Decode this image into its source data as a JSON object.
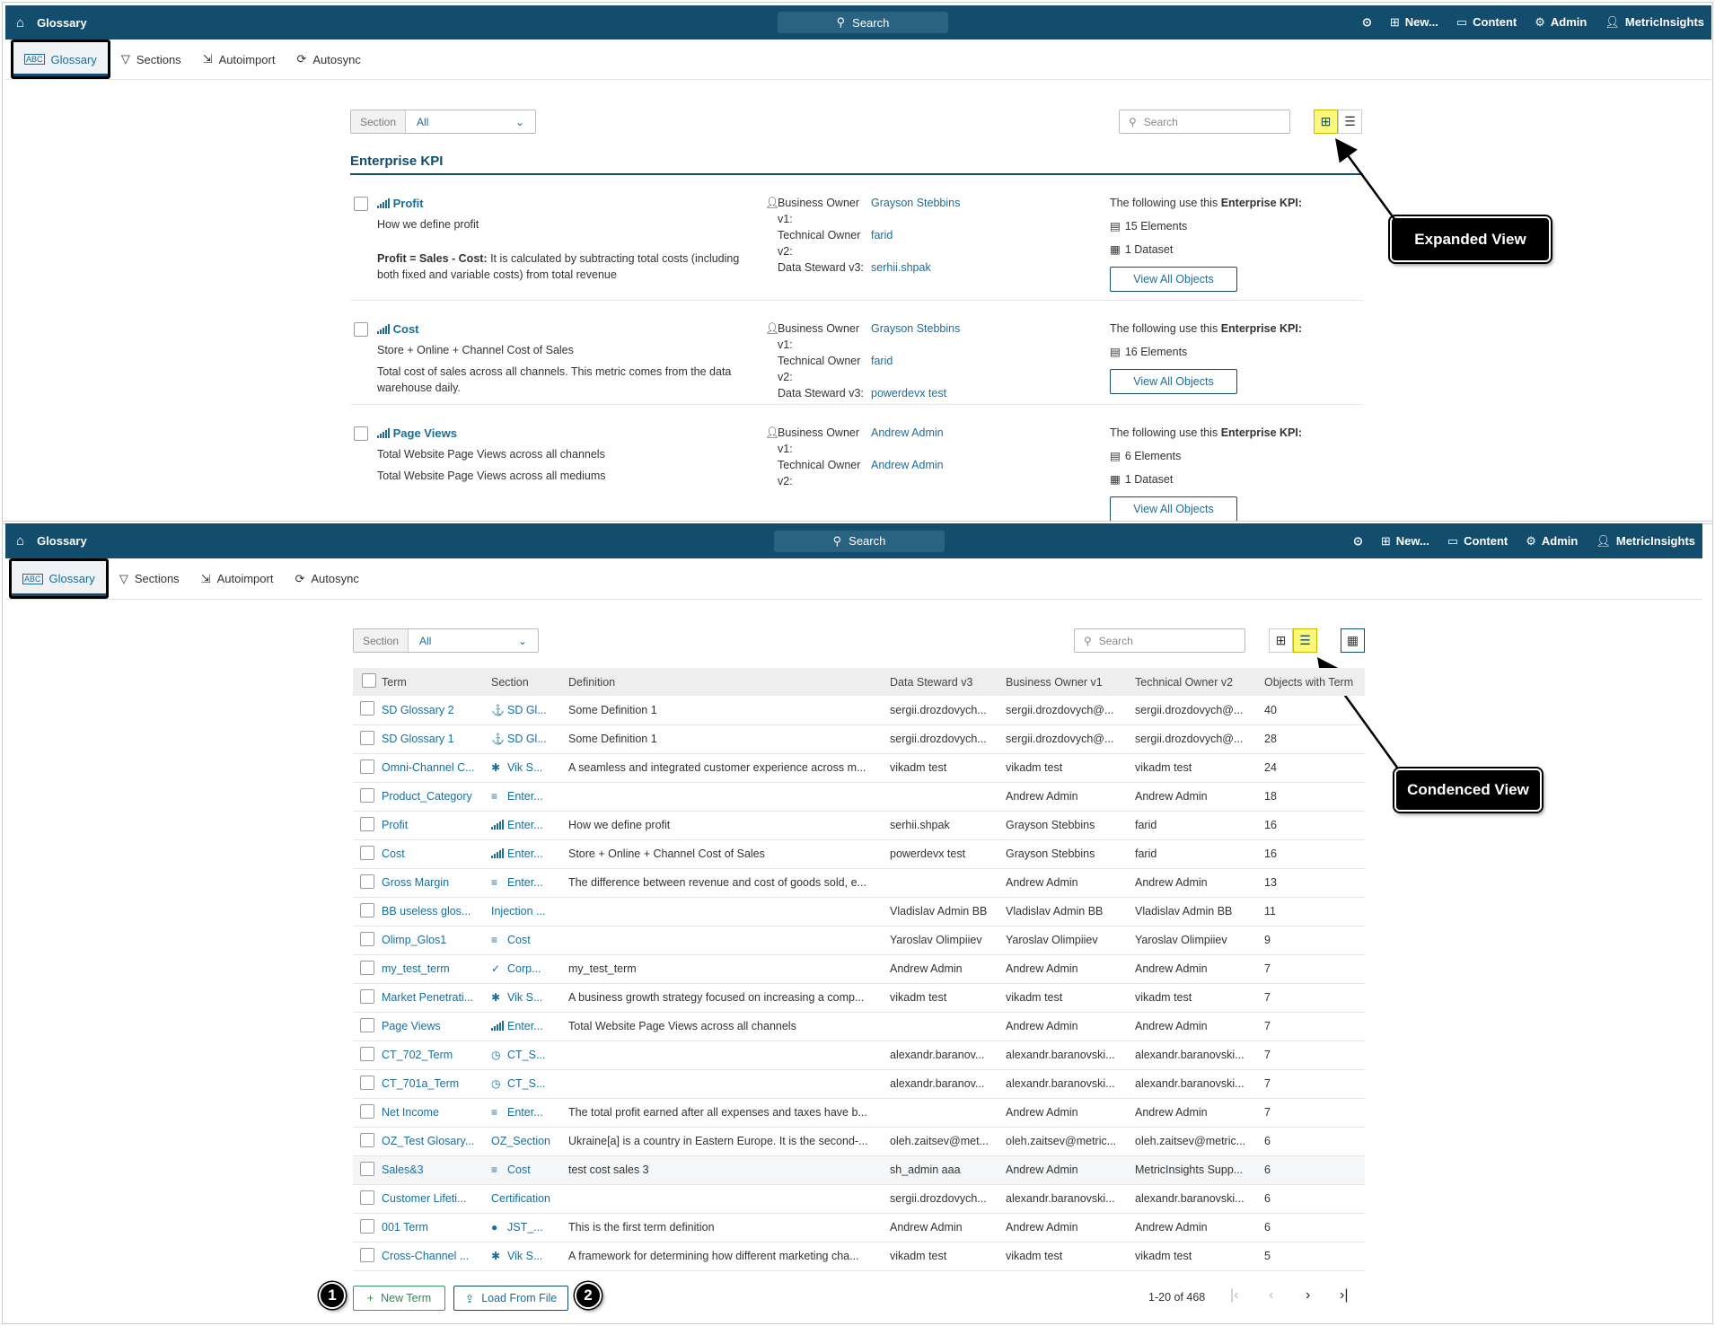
{
  "colors": {
    "brand": "#124d6e",
    "link": "#1a6e9a",
    "highlight": "#fbf77a"
  },
  "topbar": {
    "title": "Glossary",
    "search": "Search",
    "new": "New...",
    "content": "Content",
    "admin": "Admin",
    "user": "MetricInsights"
  },
  "tabs": [
    "Glossary",
    "Sections",
    "Autoimport",
    "Autosync"
  ],
  "filters": {
    "section_label": "Section",
    "section_value": "All",
    "search_placeholder": "Search"
  },
  "expanded": {
    "section_title": "Enterprise KPI",
    "uses_prefix": "The following use this ",
    "uses_bold": "Enterprise KPI:",
    "view_all": "View All Objects",
    "labels": {
      "bo1": "Business Owner",
      "bo2": "v1:",
      "to1": "Technical Owner",
      "to2": "v2:",
      "ds": "Data Steward v3:"
    },
    "items": [
      {
        "title": "Profit",
        "desc1": "How we define profit",
        "desc2_bold": "Profit = Sales - Cost:",
        "desc2": " It is calculated by subtracting total costs (including both fixed and variable costs) from total revenue",
        "business_owner": "Grayson Stebbins",
        "technical_owner": "farid",
        "data_steward": "serhii.shpak",
        "elements": "15 Elements",
        "datasets": "1 Dataset"
      },
      {
        "title": "Cost",
        "desc1": "Store + Online + Channel Cost of Sales",
        "desc2_bold": "",
        "desc2": "Total cost of sales across all channels. This metric comes from the data warehouse daily.",
        "business_owner": "Grayson Stebbins",
        "technical_owner": "farid",
        "data_steward": "powerdevx test",
        "elements": "16 Elements",
        "datasets": ""
      },
      {
        "title": "Page Views",
        "desc1": "Total Website Page Views across all channels",
        "desc2_bold": "",
        "desc2": "Total Website Page Views across all mediums",
        "business_owner": "Andrew Admin",
        "technical_owner": "Andrew Admin",
        "data_steward": "",
        "elements": "6 Elements",
        "datasets": "1 Dataset"
      }
    ]
  },
  "callouts": {
    "expanded": "Expanded View",
    "condensed": "Condenced View",
    "badge1": "1",
    "badge2": "2"
  },
  "table": {
    "columns": [
      "Term",
      "Section",
      "Definition",
      "Data Steward v3",
      "Business Owner v1",
      "Technical Owner v2",
      "Objects with Term"
    ],
    "rows": [
      {
        "term": "SD Glossary 2",
        "icon": "anchor-icon",
        "section": "SD Gl...",
        "definition": "Some Definition 1",
        "steward": "sergii.drozdovych...",
        "bo": "sergii.drozdovych@...",
        "to": "sergii.drozdovych@...",
        "objects": "40"
      },
      {
        "term": "SD Glossary 1",
        "icon": "anchor-icon",
        "section": "SD Gl...",
        "definition": "Some Definition 1",
        "steward": "sergii.drozdovych...",
        "bo": "sergii.drozdovych@...",
        "to": "sergii.drozdovych@...",
        "objects": "28"
      },
      {
        "term": "Omni-Channel C...",
        "icon": "bug-icon",
        "section": "Vik S...",
        "definition": "A seamless and integrated customer experience across m...",
        "steward": "vikadm test",
        "bo": "vikadm test",
        "to": "vikadm test",
        "objects": "24"
      },
      {
        "term": "Product_Category",
        "icon": "list-icon",
        "section": "Enter...",
        "definition": "",
        "steward": "",
        "bo": "Andrew Admin",
        "to": "Andrew Admin",
        "objects": "18"
      },
      {
        "term": "Profit",
        "icon": "bar-chart-icon",
        "section": "Enter...",
        "definition": "How we define profit",
        "steward": "serhii.shpak",
        "bo": "Grayson Stebbins",
        "to": "farid",
        "objects": "16"
      },
      {
        "term": "Cost",
        "icon": "bar-chart-icon",
        "section": "Enter...",
        "definition": "Store + Online + Channel Cost of Sales",
        "steward": "powerdevx test",
        "bo": "Grayson Stebbins",
        "to": "farid",
        "objects": "16"
      },
      {
        "term": "Gross Margin",
        "icon": "list-icon",
        "section": "Enter...",
        "definition": "The difference between revenue and cost of goods sold, e...",
        "steward": "",
        "bo": "Andrew Admin",
        "to": "Andrew Admin",
        "objects": "13"
      },
      {
        "term": "BB useless glos...",
        "icon": "",
        "section": "Injection ...",
        "definition": "",
        "steward": "Vladislav Admin BB",
        "bo": "Vladislav Admin BB",
        "to": "Vladislav Admin BB",
        "objects": "11"
      },
      {
        "term": "Olimp_Glos1",
        "icon": "list-icon",
        "section": "Cost",
        "definition": "",
        "steward": "Yaroslav Olimpiiev",
        "bo": "Yaroslav Olimpiiev",
        "to": "Yaroslav Olimpiiev",
        "objects": "9"
      },
      {
        "term": "my_test_term",
        "icon": "check-icon",
        "section": "Corp...",
        "definition": "my_test_term",
        "steward": "Andrew Admin",
        "bo": "Andrew Admin",
        "to": "Andrew Admin",
        "objects": "7"
      },
      {
        "term": "Market Penetrati...",
        "icon": "bug-icon",
        "section": "Vik S...",
        "definition": "A business growth strategy focused on increasing a comp...",
        "steward": "vikadm test",
        "bo": "vikadm test",
        "to": "vikadm test",
        "objects": "7"
      },
      {
        "term": "Page Views",
        "icon": "bar-chart-icon",
        "section": "Enter...",
        "definition": "Total Website Page Views across all channels",
        "steward": "",
        "bo": "Andrew Admin",
        "to": "Andrew Admin",
        "objects": "7"
      },
      {
        "term": "CT_702_Term",
        "icon": "clock-icon",
        "section": "CT_S...",
        "definition": "",
        "steward": "alexandr.baranov...",
        "bo": "alexandr.baranovski...",
        "to": "alexandr.baranovski...",
        "objects": "7"
      },
      {
        "term": "CT_701a_Term",
        "icon": "clock-icon",
        "section": "CT_S...",
        "definition": "",
        "steward": "alexandr.baranov...",
        "bo": "alexandr.baranovski...",
        "to": "alexandr.baranovski...",
        "objects": "7"
      },
      {
        "term": "Net Income",
        "icon": "list-icon",
        "section": "Enter...",
        "definition": "The total profit earned after all expenses and taxes have b...",
        "steward": "",
        "bo": "Andrew Admin",
        "to": "Andrew Admin",
        "objects": "7"
      },
      {
        "term": "OZ_Test Glosary...",
        "icon": "",
        "section": "OZ_Section",
        "definition": "Ukraine[a] is a country in Eastern Europe. It is the second-...",
        "steward": "oleh.zaitsev@met...",
        "bo": "oleh.zaitsev@metric...",
        "to": "oleh.zaitsev@metric...",
        "objects": "6"
      },
      {
        "term": "Sales&3",
        "icon": "list-icon",
        "section": "Cost",
        "definition": "test cost sales 3",
        "steward": "sh_admin aaa",
        "bo": "Andrew Admin",
        "to": "MetricInsights Supp...",
        "objects": "6"
      },
      {
        "term": "Customer Lifeti...",
        "icon": "",
        "section": "Certification",
        "definition": "",
        "steward": "sergii.drozdovych...",
        "bo": "alexandr.baranovski...",
        "to": "alexandr.baranovski...",
        "objects": "6"
      },
      {
        "term": "001 Term",
        "icon": "bomb-icon",
        "section": "JST_...",
        "definition": "This is the first term definition",
        "steward": "Andrew Admin",
        "bo": "Andrew Admin",
        "to": "Andrew Admin",
        "objects": "6"
      },
      {
        "term": "Cross-Channel ...",
        "icon": "bug-icon",
        "section": "Vik S...",
        "definition": "A framework for determining how different marketing cha...",
        "steward": "vikadm test",
        "bo": "vikadm test",
        "to": "vikadm test",
        "objects": "5"
      }
    ]
  },
  "footer": {
    "new_term": "New Term",
    "load_file": "Load From File",
    "pagination": "1-20 of 468"
  }
}
